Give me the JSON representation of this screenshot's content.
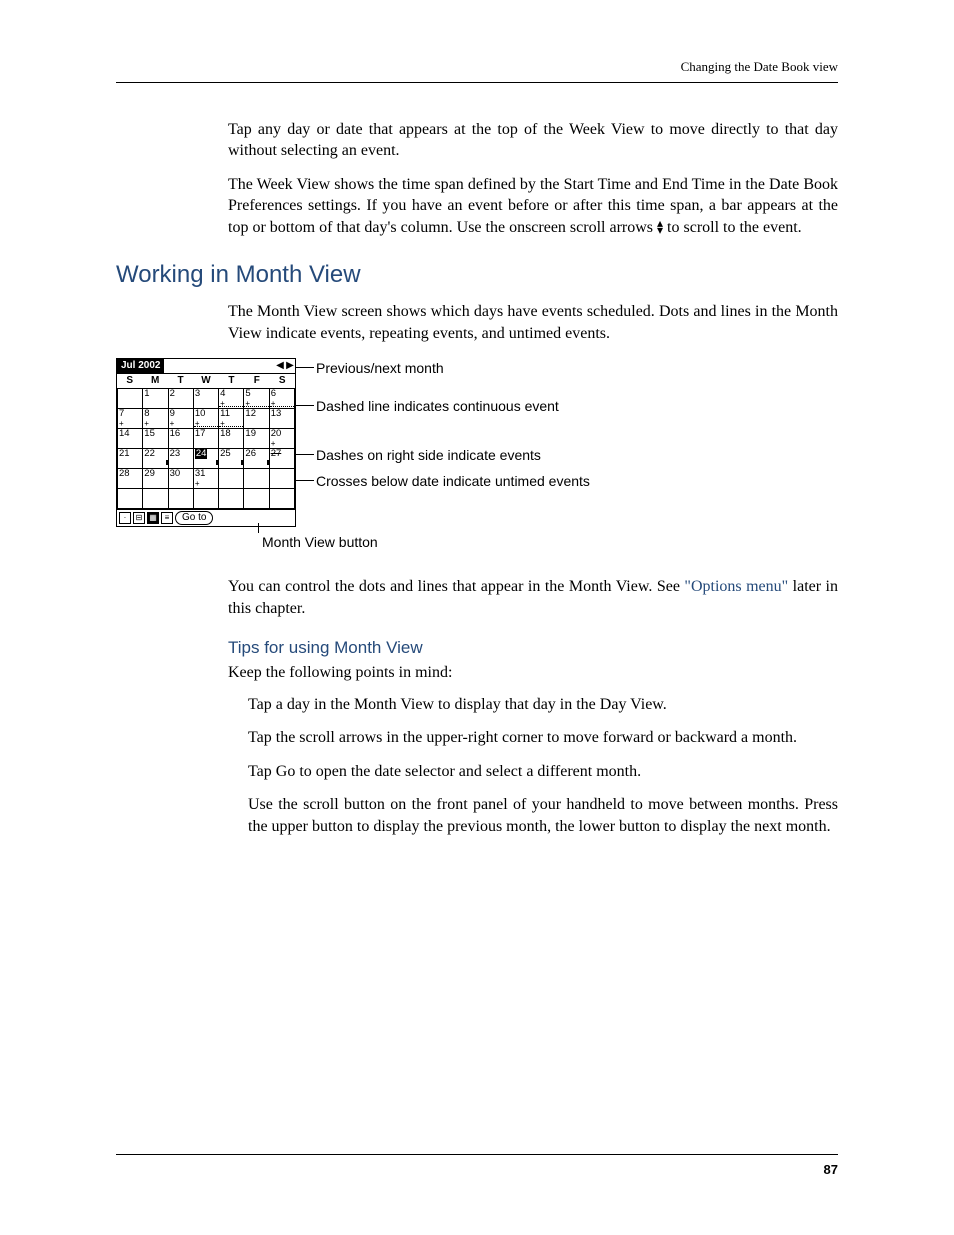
{
  "header": {
    "section": "Changing the Date Book view"
  },
  "page_number": "87",
  "para_tap_day": "Tap any day or date that appears at the top of the Week View to move directly to that day without selecting an event.",
  "para_week_view_pre": "The Week View shows the time span defined by the Start Time and End Time in the Date Book Preferences settings. If you have an event before or after this time span, a bar appears at the top or bottom of that day's column. Use the onscreen scroll arrows ",
  "para_week_view_post": " to scroll to the event.",
  "h1": "Working in Month View",
  "para_month_intro": "The Month View screen shows which days have events scheduled. Dots and lines in the Month View indicate events, repeating events, and untimed events.",
  "screenshot": {
    "title": "Jul 2002",
    "days": [
      "S",
      "M",
      "T",
      "W",
      "T",
      "F",
      "S"
    ],
    "todayCell": "24",
    "goto": "Go to"
  },
  "callout1": "Previous/next month",
  "callout2": "Dashed line indicates continuous event",
  "callout3": "Dashes on right side indicate events",
  "callout4": "Crosses below date indicate untimed events",
  "month_caption": "Month View button",
  "para_control_pre": "You can control the dots and lines that appear in the Month View. See ",
  "link_options": "\"Options menu\"",
  "para_control_post": " later in this chapter.",
  "h2": "Tips for using Month View",
  "para_keep": "Keep the following points in mind:",
  "tip1": "Tap a day in the Month View to display that day in the Day View.",
  "tip2": "Tap the scroll arrows in the upper-right corner to move forward or backward a month.",
  "tip3": "Tap Go to open the date selector and select a different month.",
  "tip4": "Use the scroll button on the front panel of your handheld to move between months. Press the upper button to display the previous month, the lower button to display the next month."
}
